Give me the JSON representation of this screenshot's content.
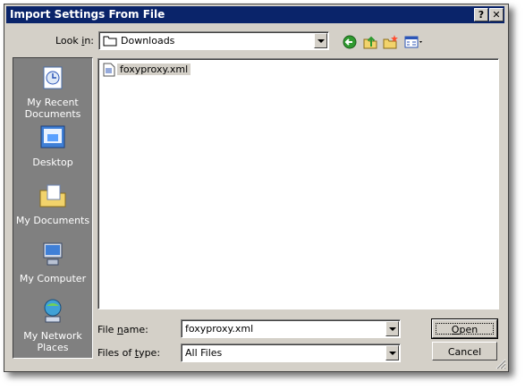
{
  "dialog": {
    "title": "Import Settings From File",
    "help_label": "?",
    "close_label": "✕"
  },
  "lookin": {
    "label_pre": "Look ",
    "label_key": "i",
    "label_post": "n:",
    "value": "Downloads"
  },
  "places": [
    {
      "label": "My Recent Documents",
      "icon": "recent-documents-icon"
    },
    {
      "label": "Desktop",
      "icon": "desktop-icon"
    },
    {
      "label": "My Documents",
      "icon": "my-documents-icon"
    },
    {
      "label": "My Computer",
      "icon": "my-computer-icon"
    },
    {
      "label": "My Network Places",
      "icon": "network-places-icon"
    }
  ],
  "files": [
    {
      "name": "foxyproxy.xml",
      "icon": "xml-file-icon"
    }
  ],
  "filename": {
    "label_pre": "File ",
    "label_key": "n",
    "label_post": "ame:",
    "value": "foxyproxy.xml"
  },
  "filetype": {
    "label_pre": "Files of ",
    "label_key": "t",
    "label_post": "ype:",
    "value": "All Files"
  },
  "buttons": {
    "open_key": "O",
    "open_rest": "pen",
    "cancel": "Cancel"
  },
  "colors": {
    "titlebar": "#0a246a",
    "face": "#d4d0c8",
    "places_bg": "#808080"
  }
}
